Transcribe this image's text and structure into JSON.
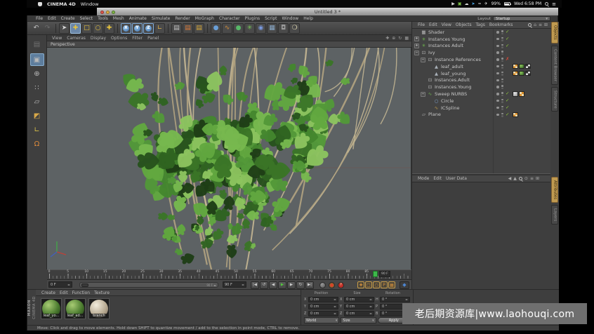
{
  "macos_bar": {
    "app_name": "CINEMA 4D",
    "menus": [
      "Window"
    ],
    "status": {
      "battery": "99%",
      "clock": "Wed 6:58 PM"
    },
    "status_icons": [
      {
        "name": "video-icon",
        "glyph": "▶",
        "color": "#dddddd"
      },
      {
        "name": "green-app-icon",
        "glyph": "▣",
        "color": "#7bc043"
      },
      {
        "name": "cloud-icon",
        "glyph": "☁",
        "color": "#dddddd"
      },
      {
        "name": "twitter-icon",
        "glyph": "➤",
        "color": "#4aa8e8"
      },
      {
        "name": "wifi-icon",
        "glyph": "≈",
        "color": "#dddddd"
      },
      {
        "name": "airport-icon",
        "glyph": "✈",
        "color": "#dddddd"
      }
    ]
  },
  "window": {
    "title": "Untitled 3 *"
  },
  "menu_bar": {
    "items": [
      "File",
      "Edit",
      "Create",
      "Select",
      "Tools",
      "Mesh",
      "Animate",
      "Simulate",
      "Render",
      "MoGraph",
      "Character",
      "Plugins",
      "Script",
      "Window",
      "Help"
    ],
    "layout": {
      "label": "Layout",
      "value": "Startup"
    }
  },
  "toolbar": {
    "items": [
      {
        "name": "undo-icon",
        "glyph": "↶",
        "fg": "#c8c8c8"
      },
      {
        "name": "redo-icon",
        "glyph": "↷",
        "fg": "#6e6e6e"
      },
      {
        "sep": true
      },
      {
        "name": "live-selection-icon",
        "glyph": "➤",
        "fg": "#d8d8d8",
        "dark": true
      },
      {
        "name": "move-tool-icon",
        "glyph": "✚",
        "fg": "#e8c43c",
        "active": true
      },
      {
        "name": "scale-tool-icon",
        "glyph": "□",
        "fg": "#e8c43c",
        "dark": true
      },
      {
        "name": "rotate-tool-icon",
        "glyph": "○",
        "fg": "#e8c43c",
        "dark": true
      },
      {
        "name": "last-tool-icon",
        "glyph": "✚",
        "fg": "#e8c43c",
        "dark": true
      },
      {
        "sep": true
      },
      {
        "name": "lock-x-axis-icon",
        "glyph": "X",
        "axis": true
      },
      {
        "name": "lock-y-axis-icon",
        "glyph": "Y",
        "axis": true
      },
      {
        "name": "lock-z-axis-icon",
        "glyph": "Z",
        "axis": true
      },
      {
        "name": "coordinate-system-icon",
        "glyph": "∟",
        "fg": "#e0b048",
        "dark": true
      },
      {
        "sep": true
      },
      {
        "name": "render-view-icon",
        "glyph": "▤",
        "fg": "#c0c0c0",
        "dark": true
      },
      {
        "name": "render-picture-viewer-icon",
        "glyph": "▤",
        "fg": "#d87838",
        "dark": true
      },
      {
        "name": "render-settings-icon",
        "glyph": "▤",
        "fg": "#d8a838",
        "dark": true
      },
      {
        "sep": true
      },
      {
        "name": "add-primitive-icon",
        "glyph": "●",
        "fg": "#6aa0d8",
        "dark": true
      },
      {
        "name": "add-spline-icon",
        "glyph": "∿",
        "fg": "#d89038",
        "dark": true
      },
      {
        "name": "add-nurbs-icon",
        "glyph": "●",
        "fg": "#58b868",
        "dark": true
      },
      {
        "name": "add-modeling-icon",
        "glyph": "✳",
        "fg": "#78c858",
        "dark": true
      },
      {
        "name": "add-deformer-icon",
        "glyph": "◉",
        "fg": "#7a9ae0",
        "dark": true
      },
      {
        "name": "add-scene-icon",
        "glyph": "▦",
        "fg": "#88a8c8",
        "dark": true
      },
      {
        "name": "add-camera-icon",
        "glyph": "◘",
        "fg": "#9a9a9a",
        "dark": true
      },
      {
        "name": "add-light-icon",
        "glyph": "❍",
        "fg": "#e8e0b8",
        "dark": true
      }
    ]
  },
  "tool_palette": [
    {
      "name": "history-icon",
      "glyph": "▤",
      "dim": true
    },
    {
      "name": "make-editable-icon",
      "glyph": "▣",
      "active": true
    },
    {
      "name": "model-mode-icon",
      "glyph": "⊕"
    },
    {
      "name": "point-mode-icon",
      "glyph": "∷"
    },
    {
      "name": "edge-mode-icon",
      "glyph": "▱"
    },
    {
      "name": "polygon-mode-icon",
      "glyph": "◩",
      "fg": "#d8a848"
    },
    {
      "name": "axis-mode-icon",
      "glyph": "∟",
      "fg": "#d8c048"
    },
    {
      "name": "snap-icon",
      "glyph": "Ω",
      "fg": "#d8883c"
    }
  ],
  "viewport": {
    "menu": [
      "View",
      "Cameras",
      "Display",
      "Options",
      "Filter",
      "Panel"
    ],
    "camera_label": "Perspective",
    "nav_icons": [
      {
        "name": "viewport-move-icon",
        "glyph": "✚"
      },
      {
        "name": "viewport-zoom-icon",
        "glyph": "⊕"
      },
      {
        "name": "viewport-rotate-icon",
        "glyph": "↻"
      },
      {
        "name": "viewport-layout-icon",
        "glyph": "▦"
      }
    ]
  },
  "object_manager": {
    "menu": [
      "File",
      "Edit",
      "View",
      "Objects",
      "Tags",
      "Bookmarks"
    ],
    "menu_icons": [
      {
        "name": "search-icon",
        "kind": "mag"
      },
      {
        "name": "home-icon",
        "glyph": "⌂"
      },
      {
        "name": "list-icon",
        "glyph": "≡"
      },
      {
        "name": "grid-icon",
        "glyph": "⊞"
      }
    ],
    "tabs": [
      {
        "label": "Objects",
        "active": true
      },
      {
        "label": "Content Browser",
        "active": false
      },
      {
        "label": "Structure",
        "active": false
      }
    ],
    "tree": [
      {
        "name": "Shader",
        "depth": 0,
        "icon": "shader-icon",
        "expander": "",
        "state": "check",
        "tags": []
      },
      {
        "name": "Instances Young",
        "depth": 0,
        "icon": "array-icon",
        "expander": "+",
        "state": "check",
        "tags": []
      },
      {
        "name": "Instances Adult",
        "depth": 0,
        "icon": "array-icon",
        "expander": "+",
        "state": "check",
        "tags": []
      },
      {
        "name": "Ivy",
        "depth": 0,
        "icon": "instance-icon",
        "expander": "-",
        "state": "none",
        "tags": []
      },
      {
        "name": "Instance References",
        "depth": 1,
        "icon": "instance-icon",
        "expander": "-",
        "state": "cross",
        "tags": []
      },
      {
        "name": "leaf_adult",
        "depth": 2,
        "icon": "cone-icon",
        "expander": "",
        "state": "none",
        "tags": [
          "phong-tag",
          "leaf-material-tag",
          "checker-material-tag"
        ]
      },
      {
        "name": "leaf_young",
        "depth": 2,
        "icon": "cone-icon",
        "expander": "",
        "state": "none",
        "tags": [
          "phong-tag",
          "leaf-material-tag",
          "checker-material-tag"
        ]
      },
      {
        "name": "Instances.Adult",
        "depth": 1,
        "icon": "instance-icon",
        "expander": "",
        "state": "none",
        "tags": []
      },
      {
        "name": "Instances.Young",
        "depth": 1,
        "icon": "instance-icon",
        "expander": "",
        "state": "none",
        "tags": []
      },
      {
        "name": "Sweep NURBS",
        "depth": 1,
        "icon": "sweep-icon",
        "expander": "-",
        "state": "check",
        "tags": [
          "gray-material-tag",
          "phong-tag"
        ]
      },
      {
        "name": "Circle",
        "depth": 2,
        "icon": "circle-icon",
        "expander": "",
        "state": "check",
        "tags": []
      },
      {
        "name": "ICSpline",
        "depth": 2,
        "icon": "spline-icon",
        "expander": "",
        "state": "check",
        "tags": []
      },
      {
        "name": "Plane",
        "depth": 0,
        "icon": "plane-icon",
        "expander": "",
        "state": "check",
        "tags": [
          "phong-tag"
        ]
      }
    ]
  },
  "attribute_manager": {
    "menu": [
      "Mode",
      "Edit",
      "User Data"
    ],
    "menu_icons": [
      {
        "name": "back-icon",
        "glyph": "◀"
      },
      {
        "name": "up-icon",
        "glyph": "▲"
      },
      {
        "name": "search-icon",
        "kind": "mag"
      },
      {
        "name": "lock-icon",
        "glyph": "⊙"
      },
      {
        "name": "list-icon",
        "glyph": "≡"
      },
      {
        "name": "grid-icon",
        "glyph": "⊞"
      }
    ],
    "tabs": [
      {
        "label": "Attributes",
        "active": true
      },
      {
        "label": "Layers",
        "active": false
      }
    ]
  },
  "timeline": {
    "tick_labels": [
      "0",
      "5",
      "10",
      "15",
      "20",
      "25",
      "30",
      "35",
      "40",
      "45",
      "50",
      "55",
      "60",
      "65",
      "70",
      "75",
      "80",
      "85"
    ],
    "playhead_label": "90 F",
    "range_start": "0 F",
    "range_end": "90 F",
    "slider_end_label": "90 F"
  },
  "transport": {
    "buttons": [
      {
        "name": "goto-start-button",
        "glyph": "|◀"
      },
      {
        "name": "play-reverse-button",
        "glyph": "↺"
      },
      {
        "name": "previous-frame-button",
        "glyph": "◀"
      },
      {
        "name": "play-button",
        "glyph": "▶",
        "accent": "#52c83c"
      },
      {
        "name": "next-frame-button",
        "glyph": "▶"
      },
      {
        "name": "loop-button",
        "glyph": "↻"
      },
      {
        "name": "goto-end-button",
        "glyph": "▶|"
      }
    ],
    "record_buttons": [
      {
        "name": "record-keyframe-button",
        "kind": "key"
      },
      {
        "name": "autokey-button",
        "kind": "auto"
      },
      {
        "name": "record-selection-button",
        "kind": "q",
        "glyph": "?"
      }
    ],
    "key_toggles": [
      {
        "name": "record-position-toggle",
        "glyph": "✚"
      },
      {
        "name": "record-scale-toggle",
        "glyph": "□"
      },
      {
        "name": "record-rotation-toggle",
        "glyph": "○"
      },
      {
        "name": "record-parameter-toggle",
        "glyph": "P"
      },
      {
        "name": "record-pla-toggle",
        "glyph": "▦"
      }
    ],
    "keyframe_button": {
      "name": "keyframe-mode-button",
      "glyph": "◆"
    }
  },
  "materials": {
    "menu": [
      "Create",
      "Edit",
      "Function",
      "Texture"
    ],
    "brand_top": "MAXON",
    "brand_bottom": "CINEMA 4D",
    "items": [
      {
        "name": "leaf_yo...",
        "type": "leaf"
      },
      {
        "name": "leaf_ad...",
        "type": "leaf"
      },
      {
        "name": "branch",
        "type": "branch"
      }
    ]
  },
  "coordinates": {
    "groups": [
      {
        "header": "Position",
        "rows": [
          {
            "label": "X",
            "value": "0 cm"
          },
          {
            "label": "Y",
            "value": "0 cm"
          },
          {
            "label": "Z",
            "value": "0 cm"
          }
        ],
        "footer": {
          "type": "select",
          "value": "World"
        }
      },
      {
        "header": "Size",
        "rows": [
          {
            "label": "X",
            "value": "0 cm"
          },
          {
            "label": "Y",
            "value": "0 cm"
          },
          {
            "label": "Z",
            "value": "0 cm"
          }
        ],
        "footer": {
          "type": "select",
          "value": "Size"
        }
      },
      {
        "header": "Rotation",
        "rows": [
          {
            "label": "H",
            "value": "0 °"
          },
          {
            "label": "P",
            "value": "0 °"
          },
          {
            "label": "B",
            "value": "0 °"
          }
        ],
        "footer": {
          "type": "button",
          "value": "Apply"
        }
      }
    ]
  },
  "status_bar": {
    "text": "Move: Click and drag to move elements. Hold down SHIFT to quantize movement / add to the selection in point mode, CTRL to remove."
  },
  "watermark": {
    "text": "老后期资源库|www.laohouqi.com"
  }
}
